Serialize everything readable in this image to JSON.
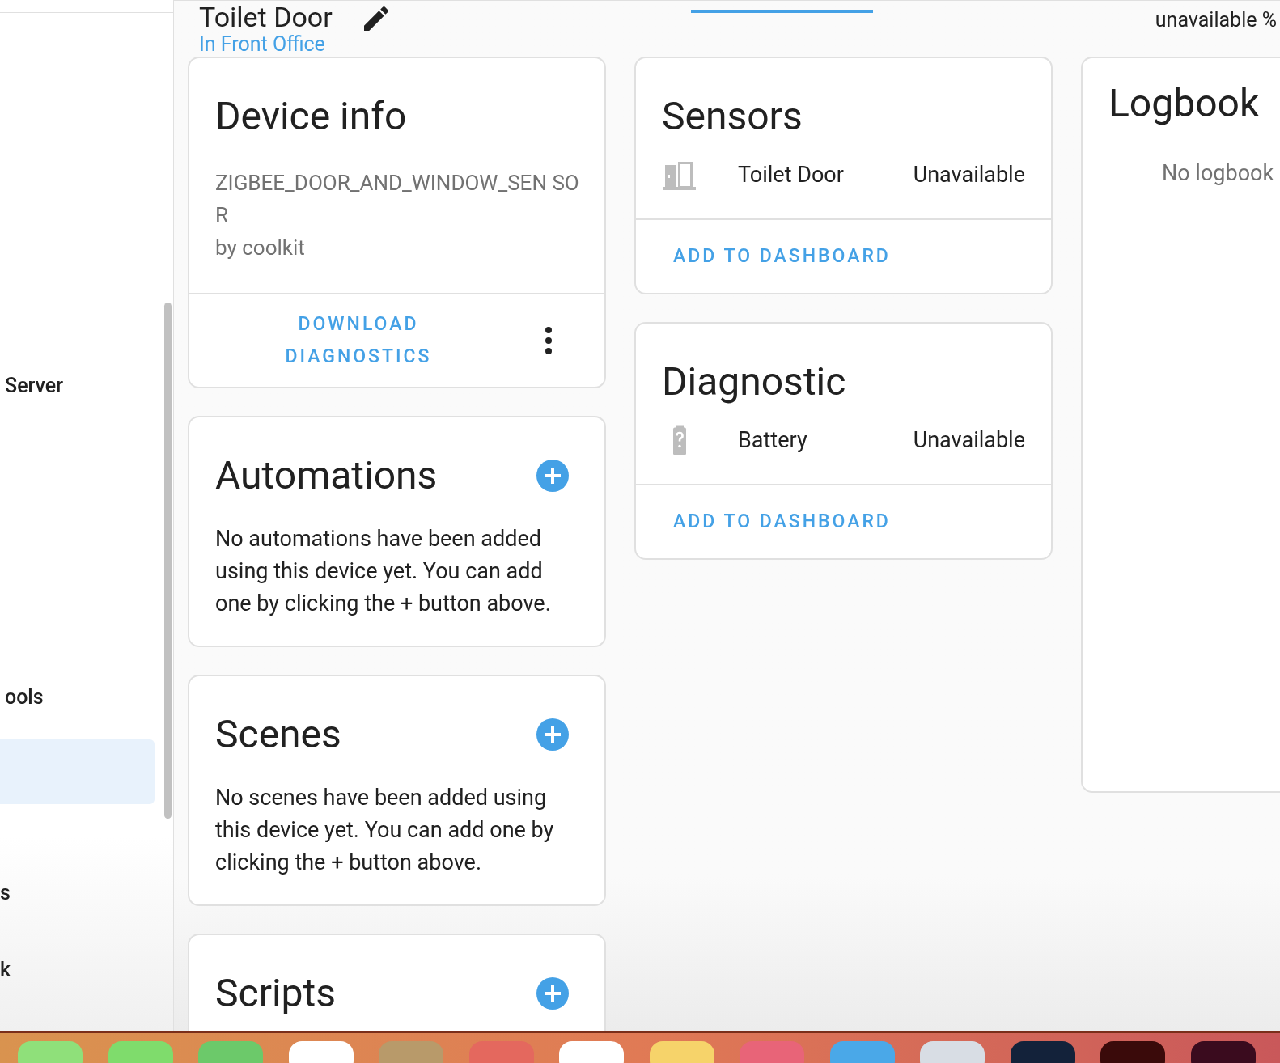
{
  "sidebar": {
    "items": [
      {
        "label": "Server",
        "selected": false
      },
      {
        "label": "ools",
        "selected": false
      },
      {
        "selected": true
      }
    ],
    "bottom_items": [
      {
        "label": "s"
      },
      {
        "label": "k"
      }
    ]
  },
  "header": {
    "title": "Toilet Door",
    "area_link": "In Front Office",
    "status": "unavailable %"
  },
  "device_info": {
    "title": "Device info",
    "model": "ZIGBEE_DOOR_AND_WINDOW_SEN SOR",
    "manufacturer": "by coolkit",
    "action": "DOWNLOAD DIAGNOSTICS"
  },
  "automations": {
    "title": "Automations",
    "text": "No automations have been added using this device yet. You can add one by clicking the + button above."
  },
  "scenes": {
    "title": "Scenes",
    "text": "No scenes have been added using this device yet. You can add one by clicking the + button above."
  },
  "scripts": {
    "title": "Scripts"
  },
  "sensors": {
    "title": "Sensors",
    "rows": [
      {
        "kind": "door",
        "name": "Toilet Door",
        "state": "Unavailable"
      }
    ],
    "action": "ADD TO DASHBOARD"
  },
  "diagnostic": {
    "title": "Diagnostic",
    "rows": [
      {
        "kind": "battery",
        "name": "Battery",
        "state": "Unavailable"
      }
    ],
    "action": "ADD TO DASHBOARD"
  },
  "logbook": {
    "title": "Logbook",
    "empty": "No logbook"
  }
}
